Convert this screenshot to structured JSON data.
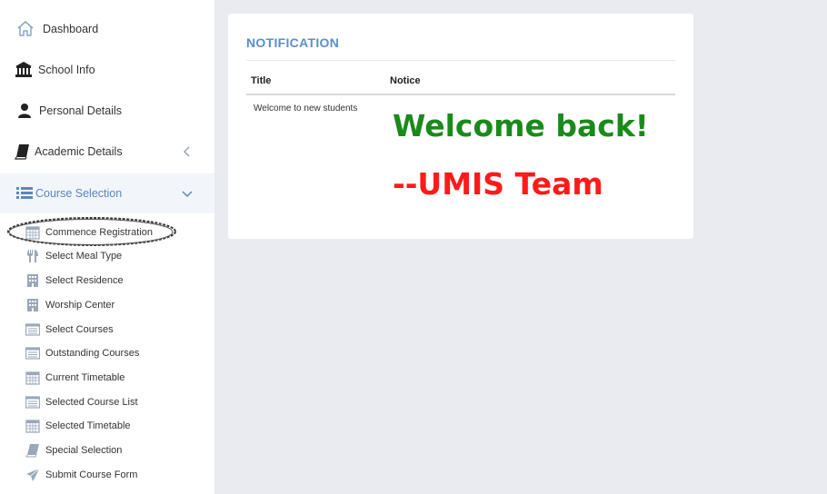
{
  "sidebar": {
    "items": [
      {
        "label": "Dashboard",
        "icon": "home-icon"
      },
      {
        "label": "School Info",
        "icon": "bank-icon"
      },
      {
        "label": "Personal Details",
        "icon": "user-icon"
      },
      {
        "label": "Academic Details",
        "icon": "book-icon"
      },
      {
        "label": "Course Selection",
        "icon": "list-icon"
      }
    ],
    "subitems": [
      {
        "label": "Commence Registration",
        "icon": "calendar-icon"
      },
      {
        "label": "Select Meal Type",
        "icon": "cutlery-icon"
      },
      {
        "label": "Select Residence",
        "icon": "building-icon"
      },
      {
        "label": "Worship Center",
        "icon": "building-icon"
      },
      {
        "label": "Select Courses",
        "icon": "list-alt-icon"
      },
      {
        "label": "Outstanding Courses",
        "icon": "list-alt-icon"
      },
      {
        "label": "Current Timetable",
        "icon": "calendar-icon"
      },
      {
        "label": "Selected Course List",
        "icon": "list-alt-icon"
      },
      {
        "label": "Selected Timetable",
        "icon": "calendar-icon"
      },
      {
        "label": "Special Selection",
        "icon": "book-icon"
      },
      {
        "label": "Submit Course Form",
        "icon": "paper-plane-icon"
      }
    ]
  },
  "notification": {
    "title": "NOTIFICATION",
    "columns": [
      "Title",
      "Notice"
    ],
    "row_title": "Welcome to new students",
    "notice_line1": "Welcome back!",
    "notice_line2": "--UMIS Team"
  },
  "colors": {
    "accent": "#5b86c2",
    "notice_green": "#1a8a1a",
    "notice_red": "#ff1a1a"
  }
}
